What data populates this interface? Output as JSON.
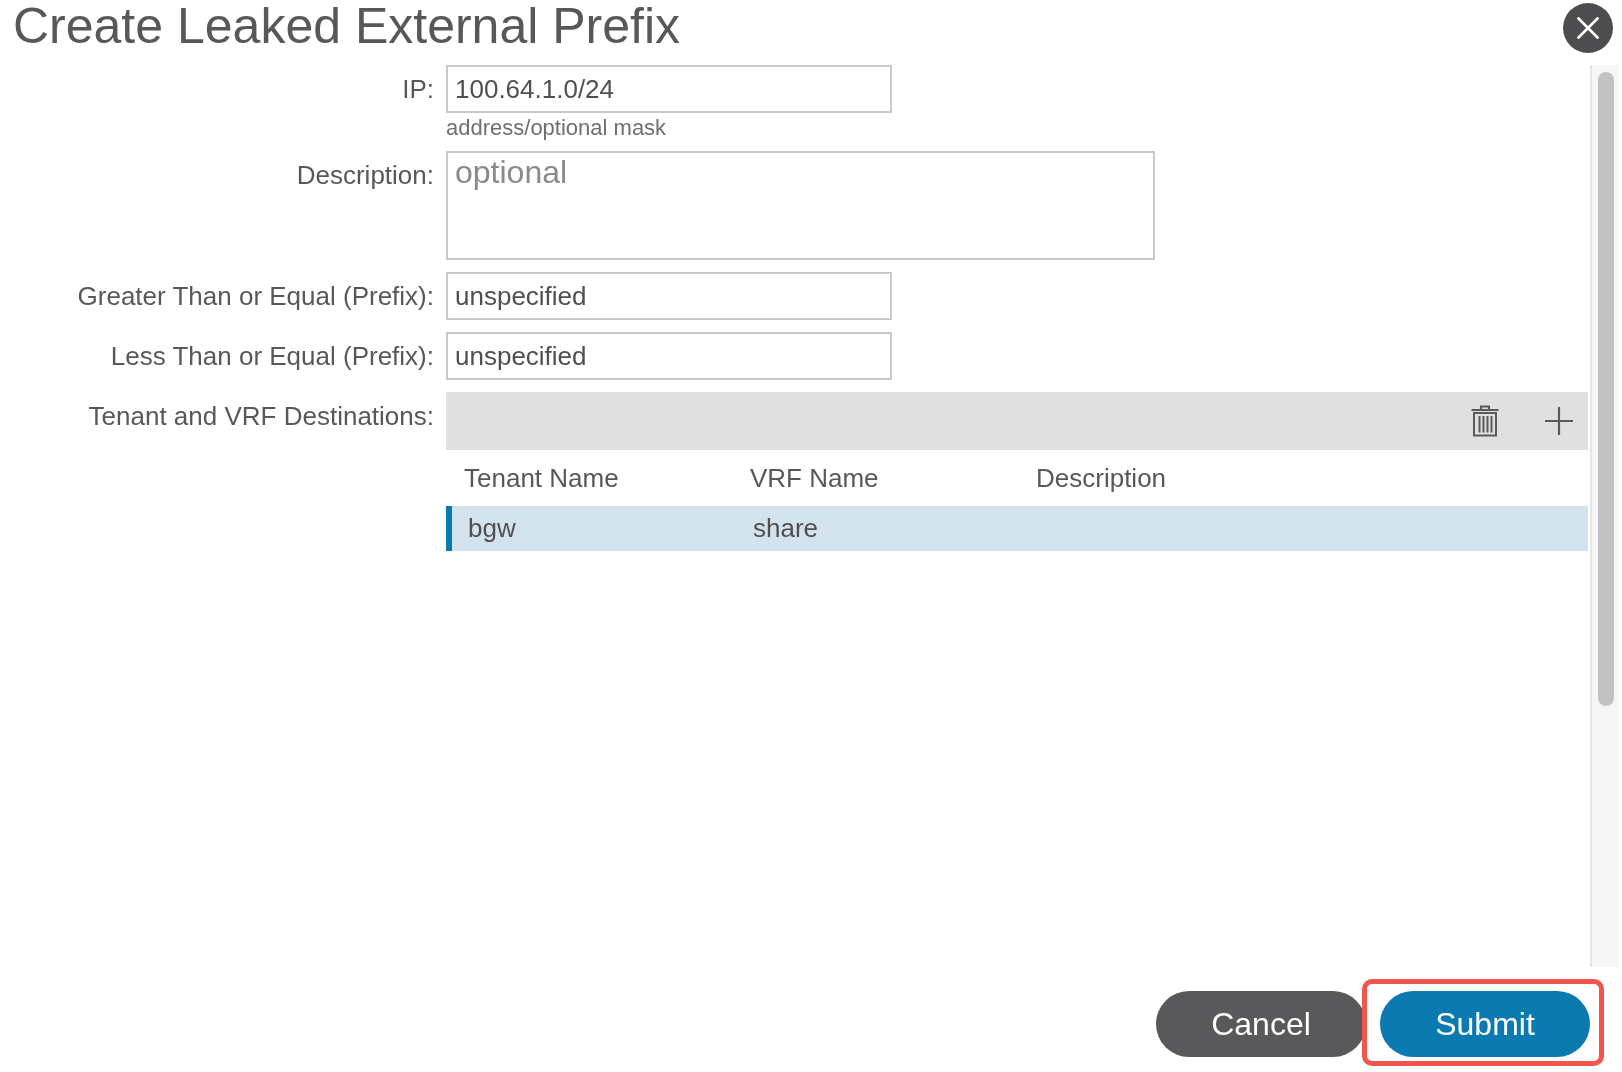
{
  "dialog": {
    "title": "Create Leaked External Prefix"
  },
  "fields": [
    {
      "kind": "input",
      "label": "IP:",
      "value": "100.64.1.0/24",
      "hint": "address/optional mask"
    },
    {
      "kind": "textarea",
      "label": "Description:",
      "placeholder": "optional"
    },
    {
      "kind": "input",
      "label": "Greater Than or Equal (Prefix):",
      "value": "unspecified"
    },
    {
      "kind": "input",
      "label": "Less Than or Equal (Prefix):",
      "value": "unspecified"
    }
  ],
  "destinations": {
    "label": "Tenant and VRF Destinations:",
    "columns": [
      "Tenant Name",
      "VRF Name",
      "Description"
    ],
    "rows": [
      {
        "cells": [
          "bgw",
          "share"
        ],
        "selected": true
      }
    ]
  },
  "buttons": [
    {
      "label": "Cancel",
      "kind": "secondary",
      "highlighted": false
    },
    {
      "label": "Submit",
      "kind": "primary",
      "highlighted": true
    }
  ]
}
